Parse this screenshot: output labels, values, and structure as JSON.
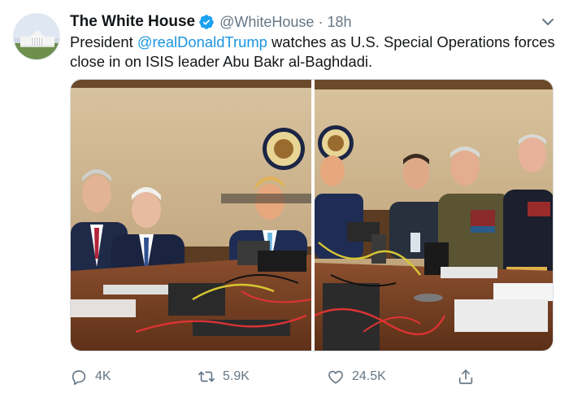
{
  "author": {
    "name": "The White House",
    "handle": "@WhiteHouse",
    "separator": "·",
    "time": "18h"
  },
  "tweet": {
    "text_prefix": "President ",
    "mention": "@realDonaldTrump",
    "text_suffix": " watches as U.S. Special Operations forces close in on ISIS leader Abu Bakr al-Baghdadi."
  },
  "actions": {
    "reply_count": "4K",
    "retweet_count": "5.9K",
    "like_count": "24.5K"
  },
  "colors": {
    "link": "#1b95e0",
    "verified": "#1da1f2",
    "muted": "#657786"
  },
  "icons": [
    "white-house-avatar",
    "verified-badge-icon",
    "chevron-down-icon",
    "reply-icon",
    "retweet-icon",
    "like-icon",
    "share-icon"
  ]
}
